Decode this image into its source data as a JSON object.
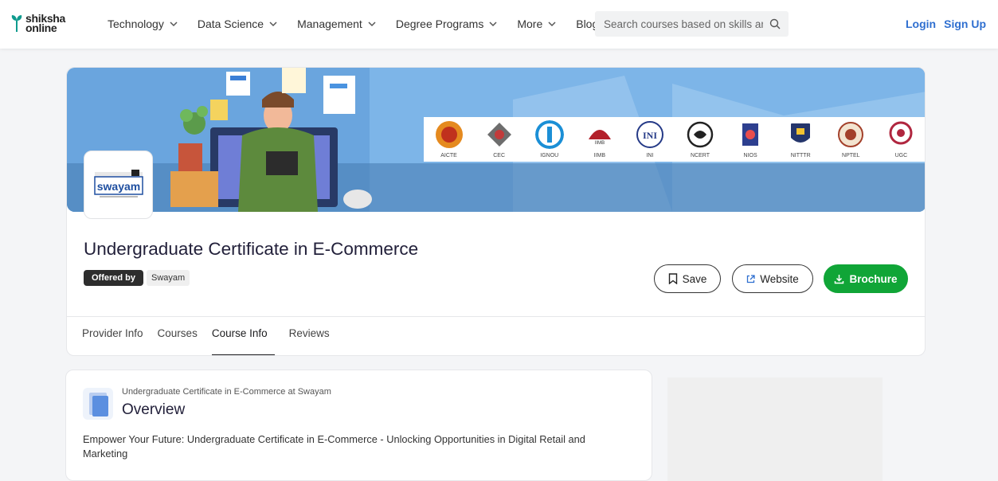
{
  "header": {
    "logo_line1": "shiksha",
    "logo_line2": "online",
    "nav": [
      {
        "label": "Technology"
      },
      {
        "label": "Data Science"
      },
      {
        "label": "Management"
      },
      {
        "label": "Degree Programs"
      },
      {
        "label": "More"
      },
      {
        "label": "Blog"
      }
    ],
    "search_placeholder": "Search courses based on skills an",
    "login": "Login",
    "signup": "Sign Up"
  },
  "banner": {
    "logos": [
      "AICTE",
      "CEC",
      "IGNOU",
      "IIMB",
      "INI",
      "NCERT",
      "NIOS",
      "NITTTR",
      "NPTEL",
      "UGC"
    ],
    "logo_inner": [
      "",
      "",
      "",
      "IIMB",
      "INI",
      "",
      "",
      "",
      "",
      ""
    ]
  },
  "provider": {
    "logo_text": "swayam"
  },
  "course": {
    "title": "Undergraduate Certificate in E-Commerce",
    "offered_by_label": "Offered by",
    "offered_by_name": "Swayam"
  },
  "actions": {
    "save": "Save",
    "website": "Website",
    "brochure": "Brochure"
  },
  "tabs": [
    {
      "label": "Provider Info"
    },
    {
      "label": "Courses"
    },
    {
      "label": "Course Info"
    },
    {
      "label": "Reviews"
    }
  ],
  "overview": {
    "subtitle": "Undergraduate Certificate in E-Commerce at Swayam",
    "title": "Overview",
    "description": "Empower Your Future: Undergraduate Certificate in E-Commerce - Unlocking Opportunities in Digital Retail and Marketing"
  },
  "colors": {
    "brand_blue": "#2f6fd0",
    "brochure_green": "#10a537"
  }
}
